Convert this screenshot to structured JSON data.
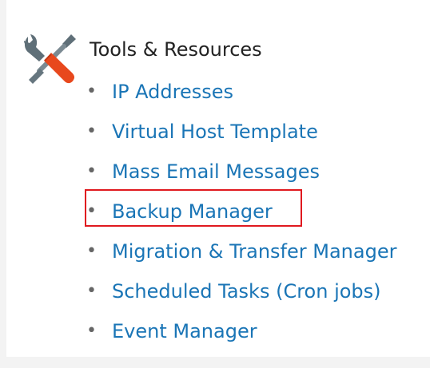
{
  "section": {
    "title": "Tools & Resources",
    "icon": "tools-icon"
  },
  "links": [
    {
      "label": "IP Addresses"
    },
    {
      "label": "Virtual Host Template"
    },
    {
      "label": "Mass Email Messages"
    },
    {
      "label": "Backup Manager",
      "highlighted": true
    },
    {
      "label": "Migration & Transfer Manager"
    },
    {
      "label": "Scheduled Tasks (Cron jobs)"
    },
    {
      "label": "Event Manager"
    }
  ],
  "colors": {
    "link": "#1a75b6",
    "title": "#222222",
    "highlight_border": "#e0191f",
    "wrench_handle": "#e8481d",
    "tool_metal": "#5f6f78"
  }
}
